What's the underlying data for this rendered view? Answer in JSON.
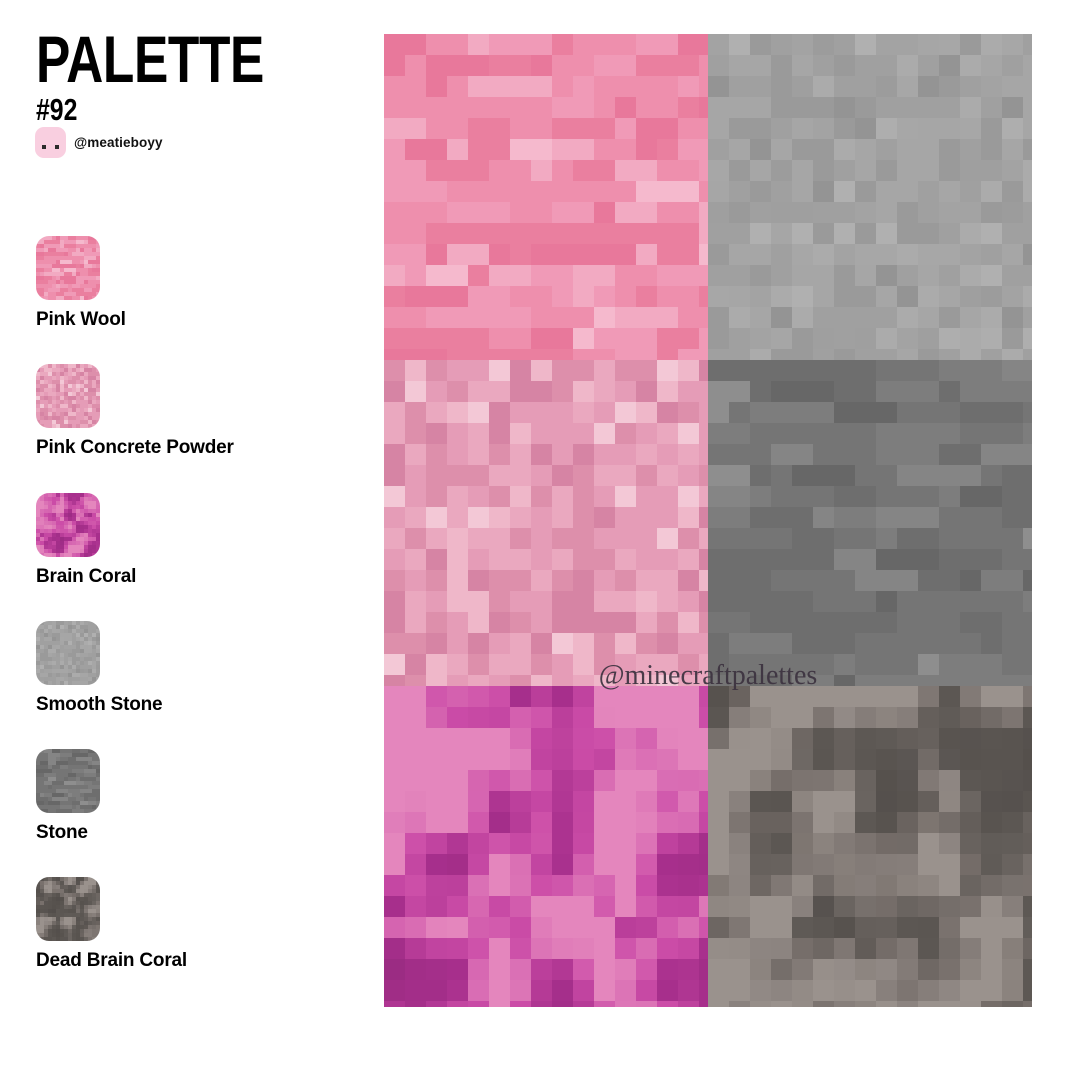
{
  "header": {
    "title": "PALETTE",
    "number": "#92",
    "author": "@meatieboyy",
    "avatar_icon": "pig-face-avatar-icon",
    "avatar_color": "#f9cfe0"
  },
  "watermark": {
    "text": "@minecraftpalettes",
    "color": "#3d3340"
  },
  "background_color": "#ffffff",
  "swatches": [
    {
      "label": "Pink Wool",
      "texture": "wool",
      "base": "#ed8fae",
      "colors": [
        "#ea7f9f",
        "#ee8fad",
        "#f09ab7",
        "#f2aac2",
        "#e8789b",
        "#f5b9cd"
      ]
    },
    {
      "label": "Pink Concrete Powder",
      "texture": "powder",
      "base": "#e598b4",
      "colors": [
        "#dd8fab",
        "#e59cb7",
        "#eaa8bf",
        "#efb7c9",
        "#d684a4",
        "#f3c8d6"
      ]
    },
    {
      "label": "Brain Coral",
      "texture": "coral",
      "base": "#cc4da8",
      "colors": [
        "#a8308d",
        "#bb3c9d",
        "#cc4da8",
        "#d867b2",
        "#e486bd",
        "#952a7e"
      ]
    },
    {
      "label": "Smooth Stone",
      "texture": "smooth",
      "base": "#a0a0a0",
      "colors": [
        "#9a9a9a",
        "#a0a0a0",
        "#a6a6a6",
        "#ababab",
        "#949494",
        "#b0b0b0"
      ]
    },
    {
      "label": "Stone",
      "texture": "stone",
      "base": "#7d7d7d",
      "colors": [
        "#6e6e6e",
        "#757575",
        "#7d7d7d",
        "#858585",
        "#8e8e8e",
        "#676767"
      ]
    },
    {
      "label": "Dead Brain Coral",
      "texture": "deadcoral",
      "base": "#7b736f",
      "colors": [
        "#5d5854",
        "#6b6561",
        "#7b736f",
        "#8a8280",
        "#9a928d",
        "#4f4a47"
      ]
    }
  ],
  "preview": {
    "columns": 2,
    "rows": 3,
    "cells": [
      {
        "row": 0,
        "col": 0,
        "swatch": "Pink Wool",
        "texture": "wool"
      },
      {
        "row": 0,
        "col": 1,
        "swatch": "Smooth Stone",
        "texture": "smooth"
      },
      {
        "row": 1,
        "col": 0,
        "swatch": "Pink Concrete Powder",
        "texture": "powder"
      },
      {
        "row": 1,
        "col": 1,
        "swatch": "Stone",
        "texture": "stone"
      },
      {
        "row": 2,
        "col": 0,
        "swatch": "Brain Coral",
        "texture": "coral"
      },
      {
        "row": 2,
        "col": 1,
        "swatch": "Dead Brain Coral",
        "texture": "deadcoral"
      }
    ]
  }
}
